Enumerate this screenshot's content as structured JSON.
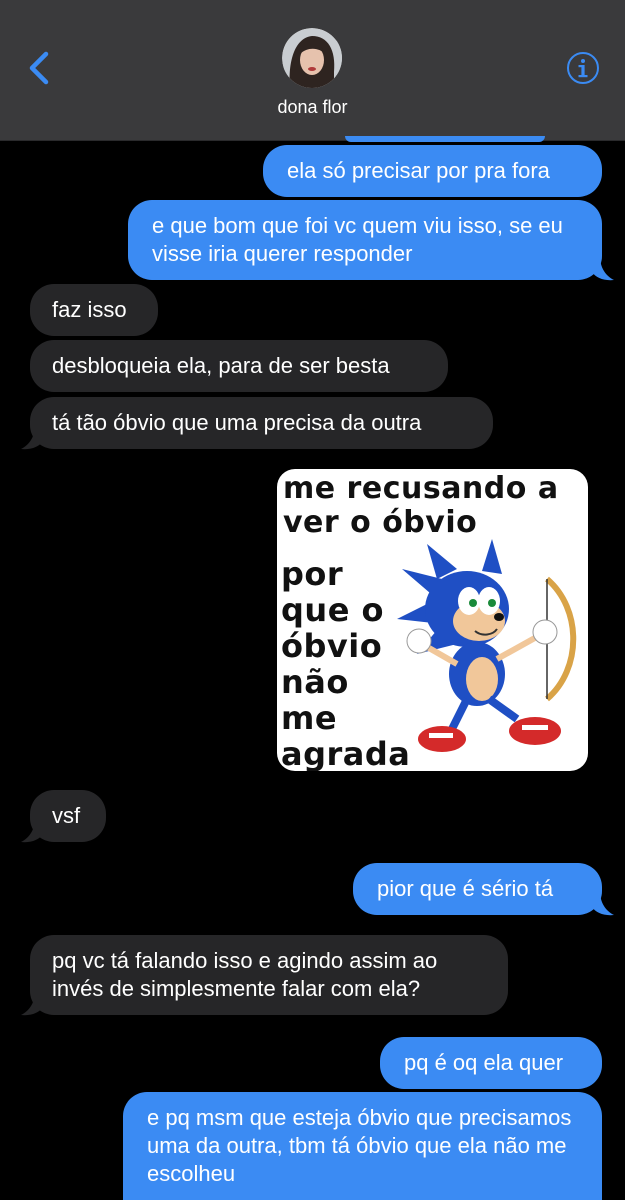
{
  "header": {
    "contact_name": "dona flor",
    "back_icon": "chevron-left-icon",
    "info_icon": "info-icon",
    "accent": "#3b8bf3"
  },
  "messages": [
    {
      "from": "me",
      "text": "ela só precisar por pra fora"
    },
    {
      "from": "me",
      "text": "e que bom que foi vc quem viu isso, se eu visse iria querer responder"
    },
    {
      "from": "them",
      "text": "faz isso"
    },
    {
      "from": "them",
      "text": "desbloqueia ela, para de ser besta"
    },
    {
      "from": "them",
      "text": "tá tão óbvio que uma precisa da outra"
    },
    {
      "from": "them",
      "text": "vsf"
    },
    {
      "from": "me",
      "text": "pior que é sério tá"
    },
    {
      "from": "them",
      "text": "pq vc tá falando isso e agindo assim ao invés de simplesmente falar com ela?"
    },
    {
      "from": "me",
      "text": "pq é oq ela quer"
    },
    {
      "from": "me",
      "text": "e pq msm que esteja óbvio que precisamos uma da outra, tbm tá óbvio que ela não me escolheu"
    }
  ],
  "meme": {
    "line1": "me recusando a",
    "line2": "ver o óbvio",
    "line3": "por",
    "line4": "que o",
    "line5": "óbvio",
    "line6": "não",
    "line7": "me",
    "line8": "agrada"
  },
  "colors": {
    "outgoing": "#3b8bf3",
    "incoming": "#262628",
    "header": "#3a3a3c"
  }
}
